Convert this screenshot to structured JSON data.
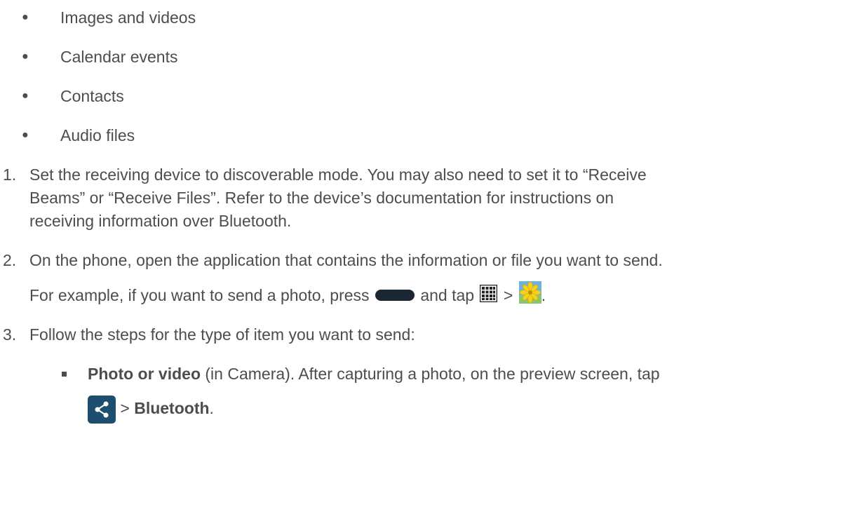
{
  "bullets": [
    {
      "dot": "●",
      "text": "Images and videos"
    },
    {
      "dot": "●",
      "text": "Calendar events"
    },
    {
      "dot": "●",
      "text": "Contacts"
    },
    {
      "dot": "●",
      "text": "Audio files"
    }
  ],
  "steps": [
    {
      "num": "1.",
      "line1": "Set the receiving device to discoverable mode. You may also need to set it to “Receive",
      "line2": "Beams” or “Receive Files”. Refer to the device’s documentation for instructions on",
      "line3": "receiving information over Bluetooth."
    },
    {
      "num": "2.",
      "line1": "On the phone, open the application that contains the information or file you want to send.",
      "example_prefix": "For example, if you want to send a photo, press",
      "example_mid": "and tap",
      "example_sep": ">",
      "example_end": "."
    },
    {
      "num": "3.",
      "line1": "Follow the steps for the type of item you want to send:"
    }
  ],
  "sub_item": {
    "bold": "Photo or video",
    "rest": " (in Camera). After capturing a photo, on the preview screen, tap",
    "sep": ">",
    "bold2": "Bluetooth",
    "end": "."
  },
  "icons": {
    "home_key": "home-key-icon",
    "apps": "apps-grid-icon",
    "gallery": "gallery-icon",
    "share": "share-icon"
  }
}
